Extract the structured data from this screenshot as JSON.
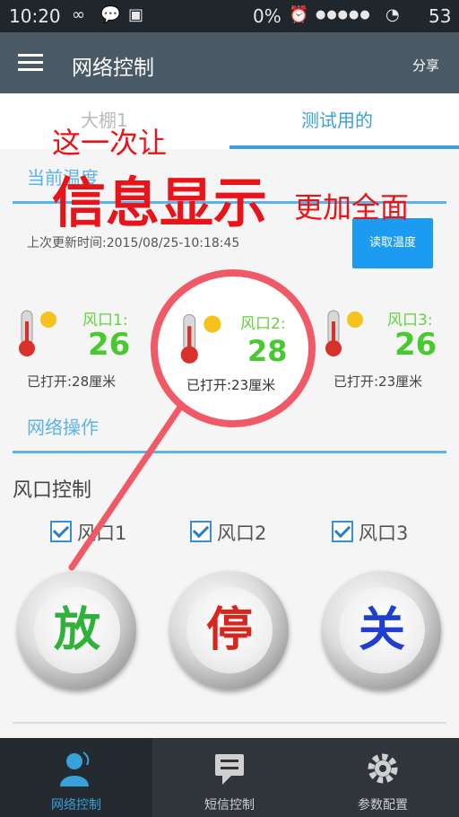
{
  "status_bar": {
    "time": "10:20",
    "signal_text": "0%",
    "battery": "53"
  },
  "app_bar": {
    "title": "网络控制",
    "share_label": "分享",
    "menu_icon": "menu-icon"
  },
  "tabs": [
    {
      "label": "大棚1",
      "active": false
    },
    {
      "label": "测试用的",
      "active": true
    }
  ],
  "current_temp_section": {
    "title": "当前温度"
  },
  "last_update": "上次更新时间:2015/08/25-10:18:45",
  "read_button_label": "读取温度",
  "vents": [
    {
      "name": "风口1:",
      "temperature": "26",
      "opened": "已打开:28厘米"
    },
    {
      "name": "风口2:",
      "temperature": "28",
      "opened": "已打开:23厘米"
    },
    {
      "name": "风口3:",
      "temperature": "26",
      "opened": "已打开:23厘米"
    }
  ],
  "network_ops_title": "网络操作",
  "vent_control": {
    "title": "风口控制",
    "checkboxes": [
      {
        "label": "风口1",
        "checked": true
      },
      {
        "label": "风口2",
        "checked": true
      },
      {
        "label": "风口3",
        "checked": true
      }
    ],
    "buttons": [
      {
        "label": "放",
        "color": "#2fb13a"
      },
      {
        "label": "停",
        "color": "#d7261f"
      },
      {
        "label": "关",
        "color": "#1f3fcf"
      }
    ]
  },
  "overlay": {
    "line1": "这一次让",
    "line2": "信息显示",
    "line3": "更加全面",
    "color": "#e8141a"
  },
  "bottom_nav": [
    {
      "label": "网络控制",
      "icon": "user-icon",
      "active": true
    },
    {
      "label": "短信控制",
      "icon": "message-icon",
      "active": false
    },
    {
      "label": "参数配置",
      "icon": "gear-icon",
      "active": false
    }
  ],
  "colors": {
    "accent": "#3aa0d8",
    "app_bar": "#4a5966",
    "temp_green": "#48c92f"
  }
}
